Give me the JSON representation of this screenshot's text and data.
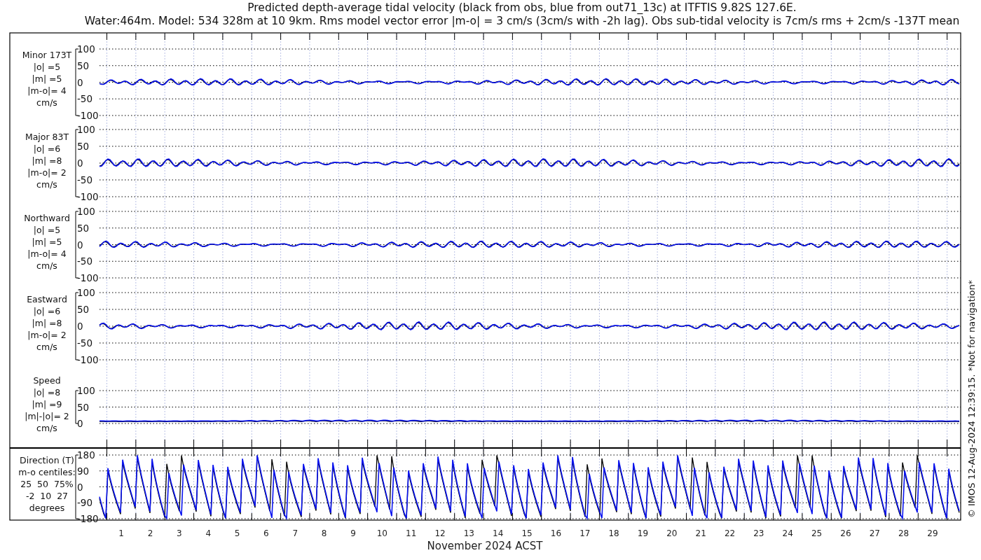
{
  "title": [
    "Predicted depth-average tidal velocity (black from obs, blue from out71_13c) at ITFTIS 9.82S 127.6E.",
    "Water:464m. Model: 534 328m at 10 9km. Rms model vector error |m-o| = 3 cm/s (3cm/s with -2h lag). Obs sub-tidal velocity is 7cm/s rms + 2cm/s -137T mean"
  ],
  "panels": [
    {
      "kind": "velocity",
      "label": [
        "Minor 173T",
        "|o| =5",
        "|m| =5",
        "|m-o|= 4",
        "cm/s"
      ],
      "yticks": [
        "100",
        "50",
        "0",
        "-50",
        "-100"
      ]
    },
    {
      "kind": "velocity",
      "label": [
        "Major 83T",
        "|o| =6",
        "|m| =8",
        "|m-o|= 2",
        "cm/s"
      ],
      "yticks": [
        "100",
        "50",
        "0",
        "-50",
        "-100"
      ]
    },
    {
      "kind": "velocity",
      "label": [
        "Northward",
        "|o| =5",
        "|m| =5",
        "|m-o|= 4",
        "cm/s"
      ],
      "yticks": [
        "100",
        "50",
        "0",
        "-50",
        "-100"
      ]
    },
    {
      "kind": "velocity",
      "label": [
        "Eastward",
        "|o| =6",
        "|m| =8",
        "|m-o|= 2",
        "cm/s"
      ],
      "yticks": [
        "100",
        "50",
        "0",
        "-50",
        "-100"
      ]
    },
    {
      "kind": "speed",
      "label": [
        "Speed",
        "|o| =8",
        "|m| =9",
        "|m|-|o|= 2",
        "cm/s"
      ],
      "yticks": [
        "100",
        "50",
        "0"
      ]
    },
    {
      "kind": "direction",
      "label": [
        "Direction (T)",
        "m-o centiles:",
        "25  50  75%",
        "-2  10  27",
        "degrees"
      ],
      "yticks": [
        "180",
        "90",
        "0",
        "-90",
        "-180"
      ]
    }
  ],
  "days": [
    "1",
    "2",
    "3",
    "4",
    "5",
    "6",
    "7",
    "8",
    "9",
    "10",
    "11",
    "12",
    "13",
    "14",
    "15",
    "16",
    "17",
    "18",
    "19",
    "20",
    "21",
    "22",
    "23",
    "24",
    "25",
    "26",
    "27",
    "28",
    "29"
  ],
  "xlabel": "November 2024 ACST",
  "credit": "© IMOS 12-Aug-2024 12:39:15. *Not for navigation*"
}
